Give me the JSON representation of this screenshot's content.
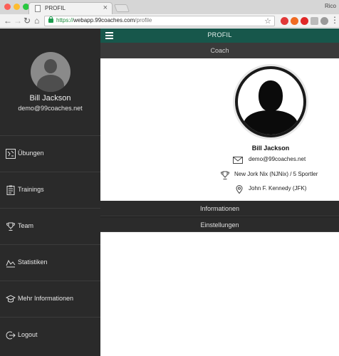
{
  "browser": {
    "tab_title": "PROFIL",
    "tab_close": "×",
    "profile_user": "Rico",
    "url_secure": "https://",
    "url_host": "webapp.99coaches.com",
    "url_path": "/profile",
    "nav": {
      "back": "←",
      "forward": "→",
      "reload": "↻",
      "home": "⌂",
      "star": "☆",
      "menu": "⋮"
    }
  },
  "sidebar": {
    "user_name": "Bill Jackson",
    "user_email": "demo@99coaches.net",
    "items": [
      {
        "label": "Übungen",
        "icon": "exercises-icon"
      },
      {
        "label": "Trainings",
        "icon": "clipboard-icon"
      },
      {
        "label": "Team",
        "icon": "trophy-icon"
      },
      {
        "label": "Statistiken",
        "icon": "chart-icon"
      },
      {
        "label": "Mehr Informationen",
        "icon": "graduation-cap-icon"
      },
      {
        "label": "Logout",
        "icon": "logout-icon"
      }
    ]
  },
  "appbar": {
    "title": "PROFIL",
    "menu_icon": "hamburger-icon"
  },
  "sections": {
    "coach": "Coach",
    "info": "Informationen",
    "settings": "Einstellungen"
  },
  "coach": {
    "name": "Bill Jackson",
    "email": "demo@99coaches.net",
    "team": "New Jork Nix (NJNix) / 5 Sportler",
    "airport": "John F. Kennedy (JFK)"
  },
  "colors": {
    "appbar": "#17574b",
    "sidebar": "#2a2a2a",
    "section": "#2b2b2b"
  }
}
